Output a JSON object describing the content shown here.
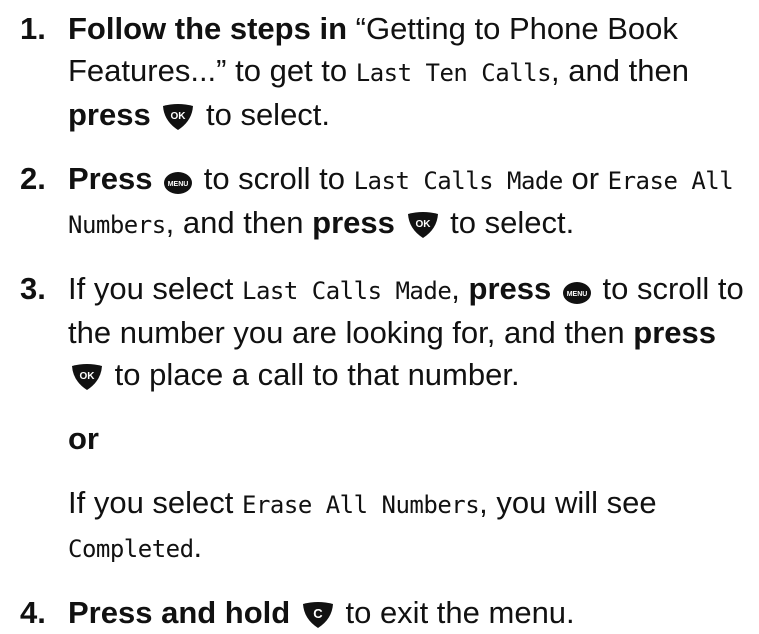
{
  "steps": [
    {
      "num": "1.",
      "t1": "Follow the steps in",
      "t2": " “Getting to Phone Book Features...” to get to ",
      "lcd1": "Last Ten Calls",
      "t3": ", and then ",
      "b2": "press",
      "t4": " to select."
    },
    {
      "num": "2.",
      "b1": "Press",
      "t1": " to scroll to ",
      "lcd1": "Last Calls Made",
      "t2": " or ",
      "lcd2": "Erase All Numbers",
      "t3": ", and then ",
      "b2": "press",
      "t4": " to select."
    },
    {
      "num": "3.",
      "t1": "If you select ",
      "lcd1": "Last Calls Made",
      "t2": ", ",
      "b1": "press",
      "t3": " to scroll to the number you are looking for, and then ",
      "b2": "press",
      "t4": " to place a call to that number.",
      "or": "or",
      "alt1": "If you select ",
      "alt_lcd": "Erase All Numbers",
      "alt2": ", you will see ",
      "alt_lcd2": "Completed",
      "alt3": "."
    },
    {
      "num": "4.",
      "b1": "Press and hold",
      "t1": " to exit the menu."
    }
  ],
  "icons": {
    "ok_label": "OK",
    "menu_label": "MENU",
    "c_label": "C"
  }
}
